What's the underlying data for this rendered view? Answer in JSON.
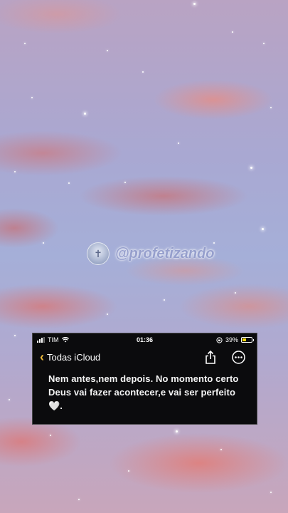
{
  "watermark": {
    "handle": "@profetizando"
  },
  "status_bar": {
    "carrier": "TIM",
    "time": "01:36",
    "battery_percent": "39%",
    "battery_level": 0.39,
    "battery_color": "#f5d90a"
  },
  "nav": {
    "back_label": "Todas iCloud",
    "accent_color": "#e9b73a",
    "share_icon": "share-icon",
    "more_icon": "more-options-icon"
  },
  "note": {
    "text": "Nem antes,nem depois. No momento certo Deus vai fazer acontecer,e vai ser perfeito🤍."
  }
}
